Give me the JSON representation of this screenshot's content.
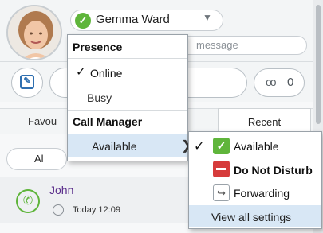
{
  "user": {
    "name": "Gemma Ward"
  },
  "status_message": {
    "placeholder": "message"
  },
  "toolbar": {
    "voicemail_count": "0"
  },
  "tabs": {
    "favourites": "Favou",
    "recent": "Recent"
  },
  "filter": {
    "all_label": "Al"
  },
  "contact": {
    "name": "John",
    "time": "Today 12:09"
  },
  "presence_menu": {
    "heading": "Presence",
    "items": [
      "Online",
      "Busy"
    ],
    "call_manager_heading": "Call Manager",
    "call_manager_item": "Available"
  },
  "submenu": {
    "items": [
      "Available",
      "Do Not Disturb",
      "Forwarding",
      "View all settings"
    ]
  },
  "icons": {
    "check": "✓",
    "chevron_right": "❯",
    "dropdown": "▼",
    "voicemail": "oo",
    "phone": "✆"
  },
  "colors": {
    "available": "#5fb53b",
    "do_not_disturb": "#d63b3b",
    "highlight": "#d8e7f5",
    "contact_name": "#5a2d8b"
  }
}
